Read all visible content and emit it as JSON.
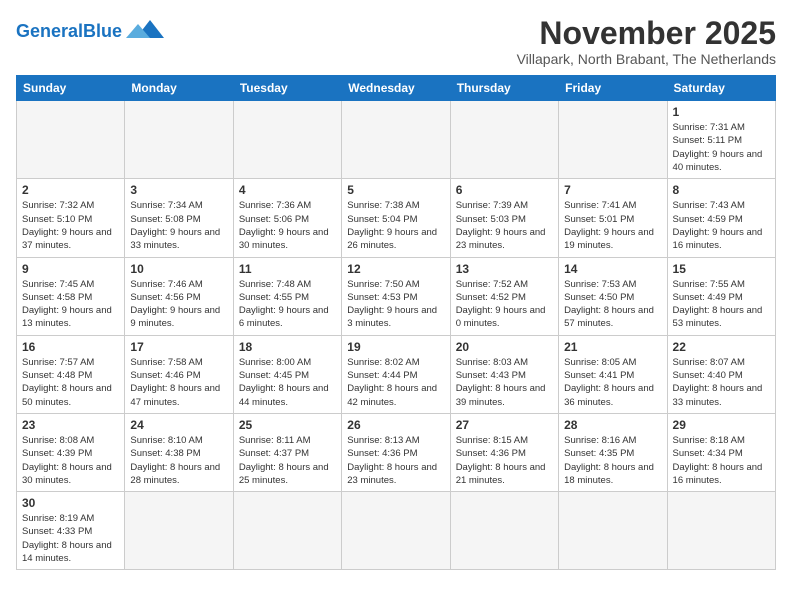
{
  "header": {
    "logo_general": "General",
    "logo_blue": "Blue",
    "month_title": "November 2025",
    "subtitle": "Villapark, North Brabant, The Netherlands"
  },
  "weekdays": [
    "Sunday",
    "Monday",
    "Tuesday",
    "Wednesday",
    "Thursday",
    "Friday",
    "Saturday"
  ],
  "days": [
    {
      "date": null,
      "number": "",
      "info": ""
    },
    {
      "date": null,
      "number": "",
      "info": ""
    },
    {
      "date": null,
      "number": "",
      "info": ""
    },
    {
      "date": null,
      "number": "",
      "info": ""
    },
    {
      "date": null,
      "number": "",
      "info": ""
    },
    {
      "date": null,
      "number": "",
      "info": ""
    },
    {
      "date": 1,
      "number": "1",
      "info": "Sunrise: 7:31 AM\nSunset: 5:11 PM\nDaylight: 9 hours and 40 minutes."
    },
    {
      "date": 2,
      "number": "2",
      "info": "Sunrise: 7:32 AM\nSunset: 5:10 PM\nDaylight: 9 hours and 37 minutes."
    },
    {
      "date": 3,
      "number": "3",
      "info": "Sunrise: 7:34 AM\nSunset: 5:08 PM\nDaylight: 9 hours and 33 minutes."
    },
    {
      "date": 4,
      "number": "4",
      "info": "Sunrise: 7:36 AM\nSunset: 5:06 PM\nDaylight: 9 hours and 30 minutes."
    },
    {
      "date": 5,
      "number": "5",
      "info": "Sunrise: 7:38 AM\nSunset: 5:04 PM\nDaylight: 9 hours and 26 minutes."
    },
    {
      "date": 6,
      "number": "6",
      "info": "Sunrise: 7:39 AM\nSunset: 5:03 PM\nDaylight: 9 hours and 23 minutes."
    },
    {
      "date": 7,
      "number": "7",
      "info": "Sunrise: 7:41 AM\nSunset: 5:01 PM\nDaylight: 9 hours and 19 minutes."
    },
    {
      "date": 8,
      "number": "8",
      "info": "Sunrise: 7:43 AM\nSunset: 4:59 PM\nDaylight: 9 hours and 16 minutes."
    },
    {
      "date": 9,
      "number": "9",
      "info": "Sunrise: 7:45 AM\nSunset: 4:58 PM\nDaylight: 9 hours and 13 minutes."
    },
    {
      "date": 10,
      "number": "10",
      "info": "Sunrise: 7:46 AM\nSunset: 4:56 PM\nDaylight: 9 hours and 9 minutes."
    },
    {
      "date": 11,
      "number": "11",
      "info": "Sunrise: 7:48 AM\nSunset: 4:55 PM\nDaylight: 9 hours and 6 minutes."
    },
    {
      "date": 12,
      "number": "12",
      "info": "Sunrise: 7:50 AM\nSunset: 4:53 PM\nDaylight: 9 hours and 3 minutes."
    },
    {
      "date": 13,
      "number": "13",
      "info": "Sunrise: 7:52 AM\nSunset: 4:52 PM\nDaylight: 9 hours and 0 minutes."
    },
    {
      "date": 14,
      "number": "14",
      "info": "Sunrise: 7:53 AM\nSunset: 4:50 PM\nDaylight: 8 hours and 57 minutes."
    },
    {
      "date": 15,
      "number": "15",
      "info": "Sunrise: 7:55 AM\nSunset: 4:49 PM\nDaylight: 8 hours and 53 minutes."
    },
    {
      "date": 16,
      "number": "16",
      "info": "Sunrise: 7:57 AM\nSunset: 4:48 PM\nDaylight: 8 hours and 50 minutes."
    },
    {
      "date": 17,
      "number": "17",
      "info": "Sunrise: 7:58 AM\nSunset: 4:46 PM\nDaylight: 8 hours and 47 minutes."
    },
    {
      "date": 18,
      "number": "18",
      "info": "Sunrise: 8:00 AM\nSunset: 4:45 PM\nDaylight: 8 hours and 44 minutes."
    },
    {
      "date": 19,
      "number": "19",
      "info": "Sunrise: 8:02 AM\nSunset: 4:44 PM\nDaylight: 8 hours and 42 minutes."
    },
    {
      "date": 20,
      "number": "20",
      "info": "Sunrise: 8:03 AM\nSunset: 4:43 PM\nDaylight: 8 hours and 39 minutes."
    },
    {
      "date": 21,
      "number": "21",
      "info": "Sunrise: 8:05 AM\nSunset: 4:41 PM\nDaylight: 8 hours and 36 minutes."
    },
    {
      "date": 22,
      "number": "22",
      "info": "Sunrise: 8:07 AM\nSunset: 4:40 PM\nDaylight: 8 hours and 33 minutes."
    },
    {
      "date": 23,
      "number": "23",
      "info": "Sunrise: 8:08 AM\nSunset: 4:39 PM\nDaylight: 8 hours and 30 minutes."
    },
    {
      "date": 24,
      "number": "24",
      "info": "Sunrise: 8:10 AM\nSunset: 4:38 PM\nDaylight: 8 hours and 28 minutes."
    },
    {
      "date": 25,
      "number": "25",
      "info": "Sunrise: 8:11 AM\nSunset: 4:37 PM\nDaylight: 8 hours and 25 minutes."
    },
    {
      "date": 26,
      "number": "26",
      "info": "Sunrise: 8:13 AM\nSunset: 4:36 PM\nDaylight: 8 hours and 23 minutes."
    },
    {
      "date": 27,
      "number": "27",
      "info": "Sunrise: 8:15 AM\nSunset: 4:36 PM\nDaylight: 8 hours and 21 minutes."
    },
    {
      "date": 28,
      "number": "28",
      "info": "Sunrise: 8:16 AM\nSunset: 4:35 PM\nDaylight: 8 hours and 18 minutes."
    },
    {
      "date": 29,
      "number": "29",
      "info": "Sunrise: 8:18 AM\nSunset: 4:34 PM\nDaylight: 8 hours and 16 minutes."
    },
    {
      "date": 30,
      "number": "30",
      "info": "Sunrise: 8:19 AM\nSunset: 4:33 PM\nDaylight: 8 hours and 14 minutes."
    },
    {
      "date": null,
      "number": "",
      "info": ""
    },
    {
      "date": null,
      "number": "",
      "info": ""
    },
    {
      "date": null,
      "number": "",
      "info": ""
    },
    {
      "date": null,
      "number": "",
      "info": ""
    },
    {
      "date": null,
      "number": "",
      "info": ""
    },
    {
      "date": null,
      "number": "",
      "info": ""
    }
  ]
}
